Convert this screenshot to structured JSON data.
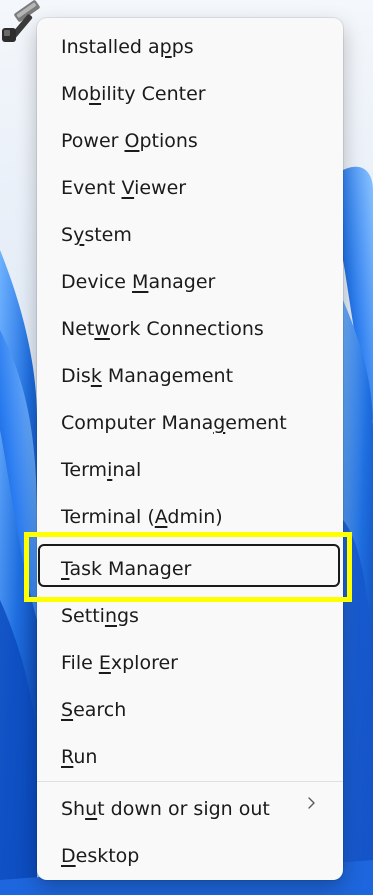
{
  "menu": {
    "items": [
      {
        "before": "Installed a",
        "key": "p",
        "after": "ps"
      },
      {
        "before": "Mo",
        "key": "b",
        "after": "ility Center"
      },
      {
        "before": "Power ",
        "key": "O",
        "after": "ptions"
      },
      {
        "before": "Event ",
        "key": "V",
        "after": "iewer"
      },
      {
        "before": "S",
        "key": "y",
        "after": "stem"
      },
      {
        "before": "Device ",
        "key": "M",
        "after": "anager"
      },
      {
        "before": "Net",
        "key": "w",
        "after": "ork Connections"
      },
      {
        "before": "Dis",
        "key": "k",
        "after": " Management"
      },
      {
        "before": "Computer Mana",
        "key": "g",
        "after": "ement"
      },
      {
        "before": "Term",
        "key": "i",
        "after": "nal"
      },
      {
        "before": "Terminal (",
        "key": "A",
        "after": "dmin)"
      },
      {
        "before": "",
        "key": "T",
        "after": "ask Manager"
      },
      {
        "before": "Setti",
        "key": "n",
        "after": "gs"
      },
      {
        "before": "File ",
        "key": "E",
        "after": "xplorer"
      },
      {
        "before": "",
        "key": "S",
        "after": "earch"
      },
      {
        "before": "",
        "key": "R",
        "after": "un"
      },
      {
        "before": "Sh",
        "key": "u",
        "after": "t down or sign out"
      },
      {
        "before": "",
        "key": "D",
        "after": "esktop"
      }
    ],
    "selected_index": 11,
    "submenu_index": 16
  },
  "colors": {
    "highlight": "#ffff00",
    "menu_bg": "#f9f9f9",
    "text": "#1b1b1b",
    "wallpaper_blue": "#1f6fe0"
  },
  "icons": {
    "app_icon": "hammer-repair-icon",
    "submenu": "chevron-right-icon"
  }
}
